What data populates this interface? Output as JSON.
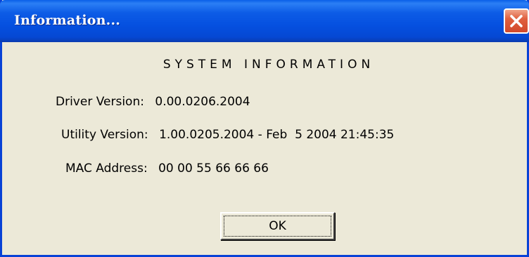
{
  "window": {
    "title": "Information...",
    "close_icon": "close-x-icon",
    "accent_color": "#0842d6",
    "close_color": "#d2492b"
  },
  "content": {
    "heading": "SYSTEM INFORMATION",
    "driver": {
      "label": "Driver Version:",
      "value": "0.00.0206.2004"
    },
    "utility": {
      "label": "Utility Version:",
      "value": "1.00.0205.2004 - Feb  5 2004 21:45:35"
    },
    "mac": {
      "label": "MAC Address:",
      "value": "00 00 55 66 66 66"
    }
  },
  "buttons": {
    "ok_label": "OK"
  }
}
